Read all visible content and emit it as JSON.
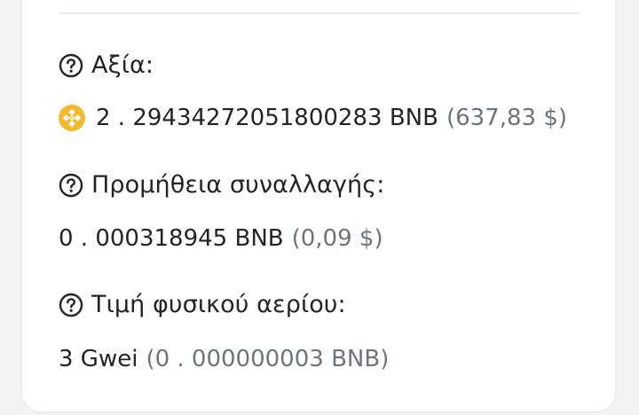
{
  "sections": [
    {
      "label": "Αξία:",
      "value": "2 . 29434272051800283 BNB",
      "fiat": "(637,83 $)"
    },
    {
      "label": "Προμήθεια συναλλαγής:",
      "value": "0 . 000318945 BNB",
      "fiat": "(0,09 $)"
    },
    {
      "label": "Τιμή φυσικού αερίου:",
      "value": "3 Gwei",
      "fiat": "(0 . 000000003 BNB)"
    }
  ],
  "icons": {
    "help": "question-circle-icon",
    "coin": "bnb-coin-icon"
  },
  "colors": {
    "coin": "#F3BA2F",
    "text": "#212529",
    "muted": "#6c757d"
  }
}
